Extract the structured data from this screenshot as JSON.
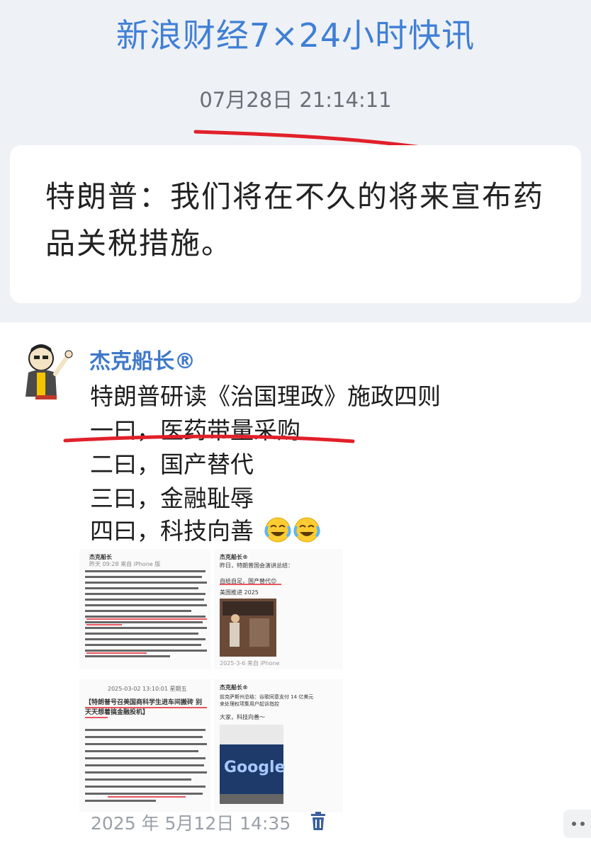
{
  "header": {
    "title": "新浪财经7×24小时快讯",
    "timestamp": "07月28日 21:14:11"
  },
  "news_card": {
    "text": "特朗普：我们将在不久的将来宣布药品关税措施。"
  },
  "post": {
    "author": "杰克船长®",
    "lines": [
      "特朗普研读《治国理政》施政四则",
      "一曰，医药带量采购",
      "二曰，国产替代",
      "三曰，金融耻辱",
      "四曰，科技向善"
    ],
    "emojis": [
      "face-with-tears-of-joy-icon",
      "face-with-tears-of-joy-icon"
    ],
    "images": {
      "img1": {
        "author": "杰克船长",
        "sub": "昨天 09:28 来自 iPhone 版"
      },
      "img2": {
        "author": "杰克船长®",
        "line1": "昨日，特朗普国会演讲总结：",
        "line2": "自给自足，国产替代😊",
        "line3": "美国推进 2025",
        "foot": "2025-3-6 来自 iPhone"
      },
      "img3": {
        "date": "2025-03-02 13:10:01 星期五",
        "headline": "【特朗普号召美国商科学生进车间搬砖 别天天想着搞金融投机】"
      },
      "img4": {
        "author": "杰克船长®",
        "line1": "前克萨斯州总结：谷歌同意支付 14 亿美元",
        "line2": "来处理权项集用户起诉指控",
        "line3": "大家，科技向善～",
        "logo": "Google"
      }
    },
    "timestamp": "2025 年 5月12日 14:35"
  },
  "colors": {
    "accent": "#3f7fd6",
    "underline": "#e1202a",
    "author": "#3f79c9"
  }
}
